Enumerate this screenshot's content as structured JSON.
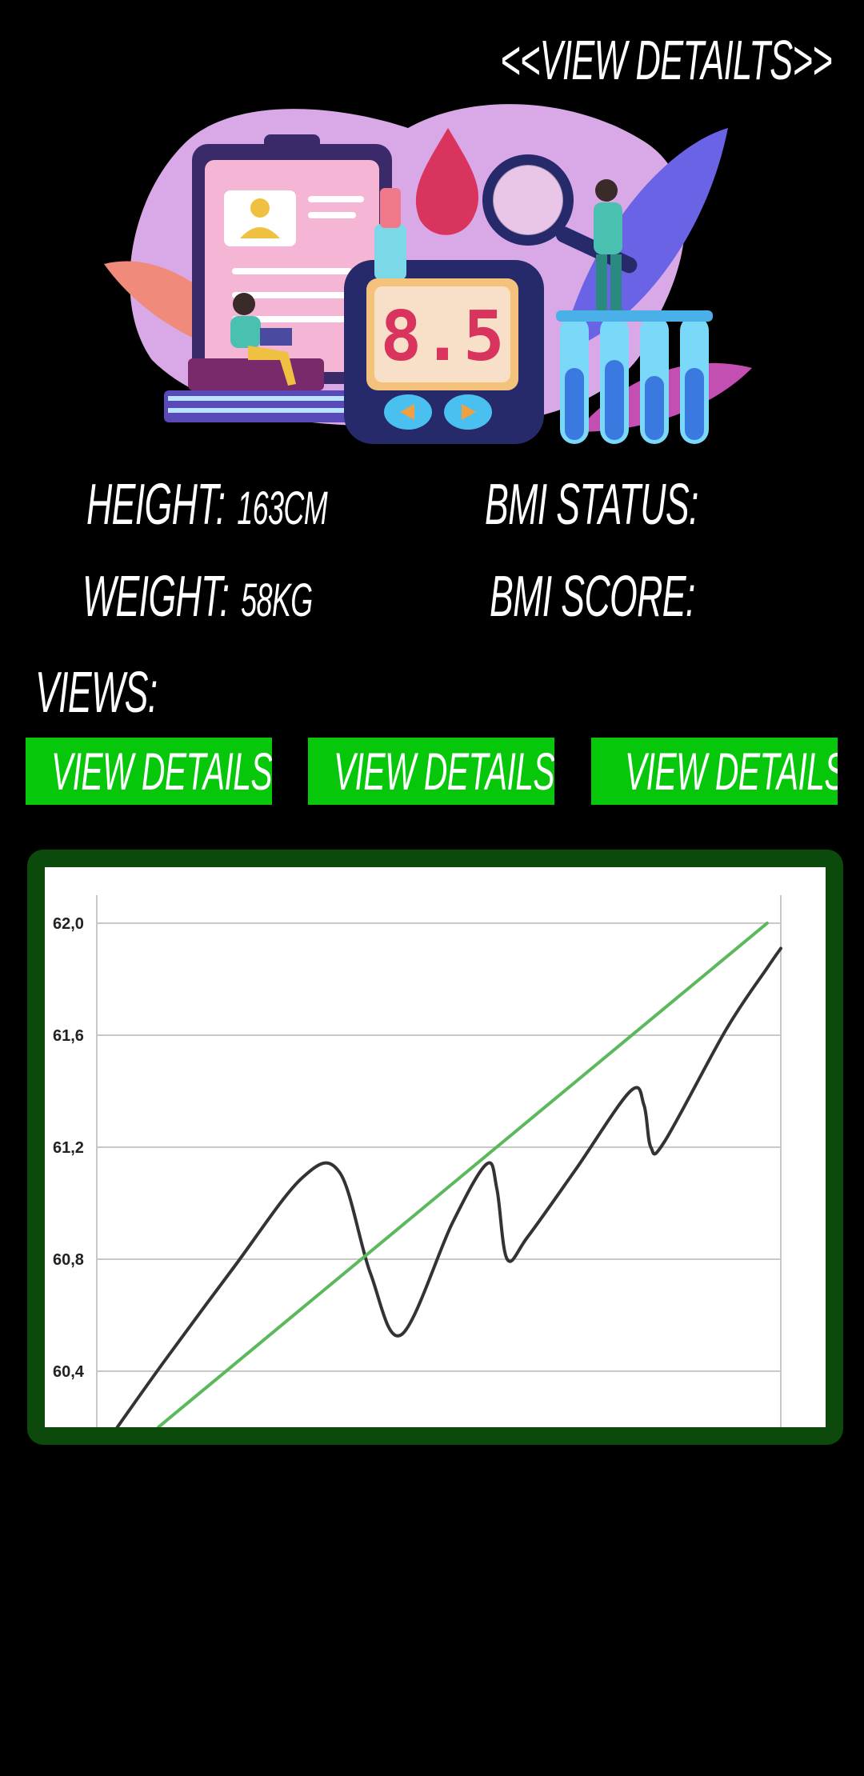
{
  "header": {
    "link_label": "<<VIEW DETAILTS>>"
  },
  "illustration": {
    "icon": "blood-glucose-meter-illustration",
    "meter_reading": "8.5"
  },
  "stats": {
    "height_label": "HEIGHT:",
    "height_value": "163CM",
    "weight_label": "WEIGHT:",
    "weight_value": "58KG",
    "bmi_status_label": "BMI STATUS:",
    "bmi_status_value": "",
    "bmi_score_label": "BMI SCORE:",
    "bmi_score_value": ""
  },
  "views": {
    "label": "VIEWS:",
    "buttons": [
      {
        "label": "VIEW DETAILS"
      },
      {
        "label": "VIEW DETAILS"
      },
      {
        "label": "VIEW DETAILS"
      }
    ]
  },
  "colors": {
    "accent": "#06c70a",
    "chart_frame": "#0b4a0b",
    "trend_line": "#5cb85c",
    "data_line": "#333333"
  },
  "chart_data": {
    "type": "line",
    "y_tick_labels": [
      "62,0",
      "61,6",
      "61,2",
      "60,8",
      "60,4"
    ],
    "y_ticks": [
      62.0,
      61.6,
      61.2,
      60.8,
      60.4
    ],
    "ylim": [
      60.2,
      62.2
    ],
    "xlim": [
      0,
      100
    ],
    "grid": true,
    "series": [
      {
        "role": "weight",
        "color": "#333333",
        "x": [
          3,
          10,
          20,
          30,
          35.5,
          40,
          44.5,
          52,
          57,
          58.5,
          60,
          63,
          70,
          78,
          80,
          81,
          83,
          92,
          98,
          100
        ],
        "y": [
          60.2,
          60.44,
          60.77,
          61.09,
          61.11,
          60.75,
          60.53,
          60.93,
          61.14,
          61.05,
          60.8,
          60.88,
          61.12,
          61.4,
          61.35,
          61.2,
          61.22,
          61.62,
          61.84,
          61.91
        ]
      },
      {
        "role": "trend",
        "color": "#5cb85c",
        "x": [
          9,
          98
        ],
        "y": [
          60.2,
          62.0
        ]
      }
    ]
  }
}
